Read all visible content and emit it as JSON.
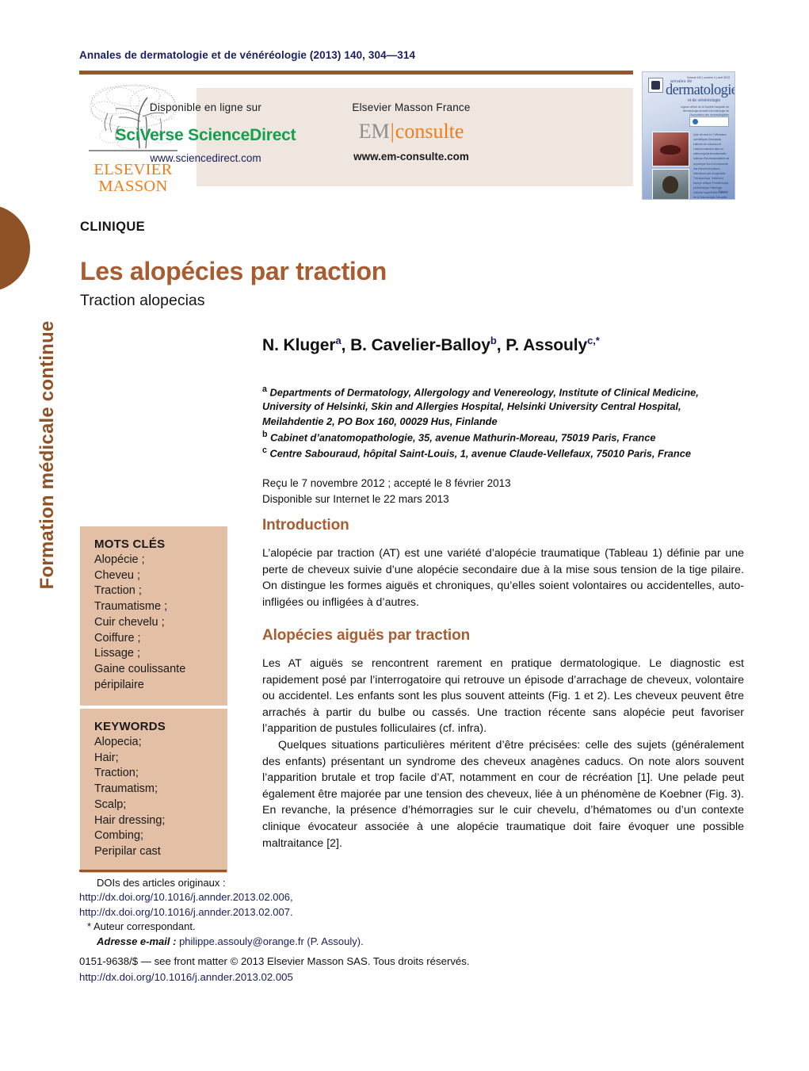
{
  "running_head": "Annales de dermatologie et de vénéréologie (2013) 140, 304—314",
  "sidebar": {
    "vertical_label": "Formation médicale continue"
  },
  "banner": {
    "publisher_logo_line1": "ELSEVIER",
    "publisher_logo_line2": "MASSON",
    "publisher_logo_icon": "elsevier-tree-logo",
    "sciencedirect": {
      "kicker": "Disponible en ligne sur",
      "brand": "SciVerse ScienceDirect",
      "url": "www.sciencedirect.com"
    },
    "emconsulte": {
      "kicker": "Elsevier Masson France",
      "brand_part1": "EM",
      "brand_divider": "|",
      "brand_part2": "consulte",
      "url": "www.em-consulte.com"
    }
  },
  "cover": {
    "masthead_small": "annales de",
    "masthead_main": "dermatologie",
    "masthead_sub": "et de vénéréologie",
    "strapline": "organe officiel de la Société française de dermatologie\nannales Dermatologie de l'Association des dermatologistes",
    "toc_editorial": "Éditorial",
    "toc_items": "Quoi de neuf en ?\n\nMémoires scientifiques\nDermatose bulleuse de nouveau-né\nLésions cutanées dans un milieu tropical\nAcrodermatite bulleuse\n\nRecommandations de la pratique\nSuivi recommandé des lésions\nDermatose infectieuse péri-anogénitale\n\nThérapeutique\nTraitement laryngé clinique\n\nPhotothérapie, photobiologie\nPathologie bulleuse superficielle\n\nHistoire de la Dermatologie\nDermatite bulleuse de Brocq",
    "volume_line": "Volume 140 | numéro 4 | avril 2013"
  },
  "article": {
    "rubric": "CLINIQUE",
    "title": "Les alopécies par traction",
    "subtitle": "Traction alopecias",
    "authors": [
      {
        "name": "N. Kluger",
        "sup": "a"
      },
      {
        "name": "B. Cavelier-Balloy",
        "sup": "b"
      },
      {
        "name": "P. Assouly",
        "sup": "c,*"
      }
    ],
    "authors_line": "N. Kluger a, B. Cavelier-Balloy b, P. Assouly c,*",
    "affiliations": [
      {
        "marker": "a",
        "text": "Departments of Dermatology, Allergology and Venereology, Institute of Clinical Medicine, University of Helsinki, Skin and Allergies Hospital, Helsinki University Central Hospital, Meilahdentie 2, PO Box 160, 00029 Hus, Finlande"
      },
      {
        "marker": "b",
        "text": "Cabinet d’anatomopathologie, 35, avenue Mathurin-Moreau, 75019 Paris, France"
      },
      {
        "marker": "c",
        "text": "Centre Sabouraud, hôpital Saint-Louis, 1, avenue Claude-Vellefaux, 75010 Paris, France"
      }
    ],
    "history_line1": "Reçu le 7 novembre 2012 ; accepté le 8 février 2013",
    "history_line2": "Disponible sur Internet le 22 mars 2013"
  },
  "keywords_fr": {
    "heading": "MOTS CLÉS",
    "items": "Alopécie ;\nCheveu ;\nTraction ;\nTraumatisme ;\nCuir chevelu ;\nCoiffure ;\nLissage ;\nGaine coulissante\npéripilaire"
  },
  "keywords_en": {
    "heading": "KEYWORDS",
    "items": "Alopecia;\nHair;\nTraction;\nTraumatism;\nScalp;\nHair dressing;\nCombing;\nPeripilar cast"
  },
  "sections": {
    "introduction": {
      "heading": "Introduction",
      "paragraph": "L’alopécie par traction (AT) est une variété d’alopécie traumatique (Tableau 1) définie par une perte de cheveux suivie d’une alopécie secondaire due à la mise sous tension de la tige pilaire. On distingue les formes aiguës et chroniques, qu’elles soient volontaires ou accidentelles, auto-infligées ou infligées à d’autres."
    },
    "acute": {
      "heading": "Alopécies aiguës par traction",
      "paragraph1": "Les AT aiguës se rencontrent rarement en pratique dermatologique. Le diagnostic est rapidement posé par l’interrogatoire qui retrouve un épisode d’arrachage de cheveux, volontaire ou accidentel. Les enfants sont les plus souvent atteints (Fig. 1 et 2). Les cheveux peuvent être arrachés à partir du bulbe ou cassés. Une traction récente sans alopécie peut favoriser l’apparition de pustules folliculaires (cf. infra).",
      "paragraph2": "Quelques situations particulières méritent d’être précisées: celle des sujets (généralement des enfants) présentant un syndrome des cheveux anagènes caducs. On note alors souvent l’apparition brutale et trop facile d’AT, notamment en cour de récréation [1]. Une pelade peut également être majorée par une tension des cheveux, liée à un phénomène de Koebner (Fig. 3). En revanche, la présence d’hémorragies sur le cuir chevelu, d’hématomes ou d’un contexte clinique évocateur associée à une alopécie traumatique doit faire évoquer une possible maltraitance [2]."
    }
  },
  "footnotes": {
    "doi_label": "DOIs des articles originaux :",
    "doi_1": "http://dx.doi.org/10.1016/j.annder.2013.02.006,",
    "doi_2": "http://dx.doi.org/10.1016/j.annder.2013.02.007.",
    "corresponding": "* Auteur correspondant.",
    "email_label": "Adresse e-mail :",
    "email_value": "philippe.assouly@orange.fr (P. Assouly).",
    "copyright": "0151-9638/$ — see front matter © 2013 Elsevier Masson SAS. Tous droits réservés.",
    "copyright_doi": "http://dx.doi.org/10.1016/j.annder.2013.02.005"
  },
  "colors": {
    "accent_brown": "#a85c30",
    "tab_brown": "#8f5226",
    "rule_brown": "#9a5626",
    "keyword_box": "#e3bfa5",
    "banner_bg": "#efe6df",
    "link_navy": "#1b2160",
    "sciencedirect_green": "#12a04a",
    "elsevier_orange": "#f07d1a"
  }
}
